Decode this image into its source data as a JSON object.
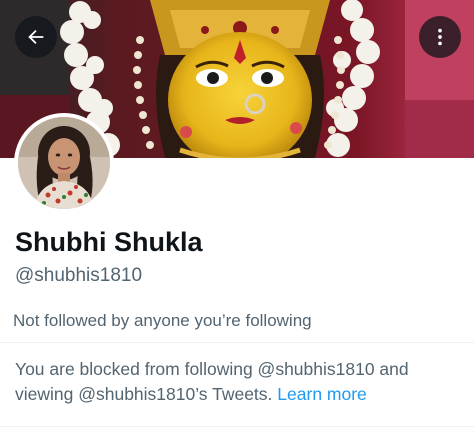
{
  "profile": {
    "display_name": "Shubhi Shukla",
    "handle": "@shubhis1810",
    "followers_note": "Not followed by anyone you’re following"
  },
  "blocked": {
    "message": "You are blocked from following @shubhis1810 and viewing @shubhis1810’s Tweets.",
    "learn_more": "Learn more"
  },
  "icons": {
    "back": "arrow-left-icon",
    "more": "more-vertical-icon"
  },
  "colors": {
    "accent": "#1d9bf0",
    "secondary_text": "#536471",
    "primary_text": "#0f1419",
    "divider": "#eff3f4"
  }
}
